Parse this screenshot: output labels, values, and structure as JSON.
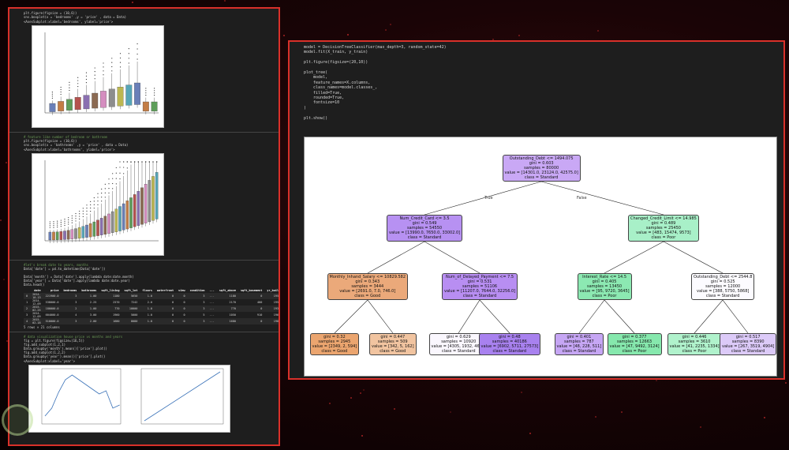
{
  "left_panel": {
    "cell1_code": [
      "plt.figure(figsize = (10,6))",
      "sns.boxplot(x = 'bedrooms' ,y = 'price' , data = Data)"
    ],
    "cell1_out": "<AxesSubplot:xlabel='bedrooms', ylabel='price'>",
    "cell2_code": [
      "# feature like number of bedroom or bathroom",
      "plt.figure(figsize = (10,6))",
      "sns.boxplot(x = 'bathrooms' ,y = 'price' , data = Data)"
    ],
    "cell2_out": "<AxesSubplot:xlabel='bathrooms', ylabel='price'>",
    "cell3_code": [
      "#let's break date to years, months",
      "Data['date'] = pd.to_datetime(Data['date'])",
      "",
      "Data['month'] = Data['date'].apply(lambda date:date.month)",
      "Data['year'] = Data['date'].apply(lambda date:date.year)",
      "Data.head()"
    ],
    "df_headers": [
      "",
      "date",
      "price",
      "bedrooms",
      "bathrooms",
      "sqft_living",
      "sqft_lot",
      "floors",
      "waterfront",
      "view",
      "condition",
      "...",
      "sqft_above",
      "sqft_basement",
      "yr_built",
      "yr_ren"
    ],
    "df_rows": [
      [
        "0",
        "2014-10-13",
        "221900.0",
        "3",
        "1.00",
        "1180",
        "5650",
        "1.0",
        "0",
        "0",
        "3",
        "...",
        "1180",
        "0",
        "1955"
      ],
      [
        "1",
        "2014-12-09",
        "538000.0",
        "3",
        "2.25",
        "2570",
        "7242",
        "2.0",
        "0",
        "0",
        "3",
        "...",
        "2170",
        "400",
        "1951"
      ],
      [
        "2",
        "2015-02-25",
        "180000.0",
        "2",
        "1.00",
        "770",
        "10000",
        "1.0",
        "0",
        "0",
        "3",
        "...",
        "770",
        "0",
        "1933"
      ],
      [
        "3",
        "2014-12-09",
        "604000.0",
        "4",
        "3.00",
        "1960",
        "5000",
        "1.0",
        "0",
        "0",
        "5",
        "...",
        "1050",
        "910",
        "1965"
      ],
      [
        "4",
        "2015-02-18",
        "510000.0",
        "3",
        "2.00",
        "1680",
        "8080",
        "1.0",
        "0",
        "0",
        "3",
        "...",
        "1680",
        "0",
        "1987"
      ]
    ],
    "df_shape": "5 rows × 21 columns",
    "cell4_code": [
      "# data visualization house price vs months and years",
      "fig = plt.figure(figsize=(16,5))",
      "fig.add_subplot(1,2,1)",
      "Data.groupby('month').mean()['price'].plot()",
      "fig.add_subplot(1,2,2)",
      "Data.groupby('year').mean()['price'].plot()"
    ],
    "cell4_out": "<AxesSubplot:xlabel='year'>"
  },
  "right_panel": {
    "code_lines": [
      "model = DecisionTreeClassifier(max_depth=3, random_state=42)",
      "model.fit(X_train, y_train)",
      "",
      "plt.figure(figsize=(20,10))",
      "",
      "plot_tree(",
      "    model,",
      "    feature_names=X.columns,",
      "    class_names=model.classes_,",
      "    filled=True,",
      "    rounded=True,",
      "    fontsize=10",
      ")",
      "",
      "plt.show()"
    ],
    "tree": {
      "edge_true": "True",
      "edge_false": "False",
      "nodes": [
        {
          "lines": [
            "Outstanding_Debt <= 1494.075",
            "gini = 0.603",
            "samples = 80000",
            "value = [14301.0, 23124.0, 42575.0]",
            "class = Standard"
          ],
          "fill": "#c9a8f5"
        },
        {
          "lines": [
            "Num_Credit_Card <= 3.5",
            "gini = 0.549",
            "samples = 54550",
            "value = [13990.0, 7650.0, 33002.0]",
            "class = Standard"
          ],
          "fill": "#b791f2"
        },
        {
          "lines": [
            "Changed_Credit_Limit <= 14.985",
            "gini = 0.489",
            "samples = 25450",
            "value = [483, 15474, 9573]",
            "class = Poor"
          ],
          "fill": "#a8f0c8"
        },
        {
          "lines": [
            "Monthly_Inhand_Salary <= 10829.582",
            "gini = 0.343",
            "samples = 3444",
            "value = [2691.0, 7.0, 746.0]",
            "class = Good"
          ],
          "fill": "#eba97a"
        },
        {
          "lines": [
            "Num_of_Delayed_Payment <= 7.5",
            "gini = 0.531",
            "samples = 51106",
            "value = [11207.0, 7644.0, 32256.0]",
            "class = Standard"
          ],
          "fill": "#b88ef2"
        },
        {
          "lines": [
            "Interest_Rate <= 14.5",
            "gini = 0.405",
            "samples = 13450",
            "value = [95, 9720, 3645]",
            "class = Poor"
          ],
          "fill": "#8ce9b2"
        },
        {
          "lines": [
            "Outstanding_Debt <= 2544.8",
            "gini = 0.525",
            "samples = 12000",
            "value = [388, 5750, 5868]",
            "class = Standard"
          ],
          "fill": "#fcfbff"
        },
        {
          "lines": [
            "gini = 0.32",
            "samples = 2945",
            "value = [2349, 2, 594]",
            "class = Good"
          ],
          "fill": "#eba56f"
        },
        {
          "lines": [
            "gini = 0.447",
            "samples = 509",
            "value = [342, 5, 162]",
            "class = Good"
          ],
          "fill": "#f1c4a0"
        },
        {
          "lines": [
            "gini = 0.629",
            "samples = 10920",
            "value = [4305, 1932, 4683]",
            "class = Standard"
          ],
          "fill": "#faf7fe"
        },
        {
          "lines": [
            "gini = 0.48",
            "samples = 40186",
            "value = [6902, 5711, 27573]",
            "class = Standard"
          ],
          "fill": "#a881ef"
        },
        {
          "lines": [
            "gini = 0.401",
            "samples = 787",
            "value = [48, 228, 511]",
            "class = Standard"
          ],
          "fill": "#c6a6f4"
        },
        {
          "lines": [
            "gini = 0.377",
            "samples = 12663",
            "value = [47, 9492, 3124]",
            "class = Poor"
          ],
          "fill": "#86e8ad"
        },
        {
          "lines": [
            "gini = 0.446",
            "samples = 3610",
            "value = [41, 2235, 1334]",
            "class = Poor"
          ],
          "fill": "#b0f2cc"
        },
        {
          "lines": [
            "gini = 0.517",
            "samples = 8390",
            "value = [267, 3519, 4904]",
            "class = Standard"
          ],
          "fill": "#dccaf8"
        }
      ]
    }
  },
  "colors": {
    "frame": "#d9302a",
    "editor_bg": "#1e1e1e"
  }
}
